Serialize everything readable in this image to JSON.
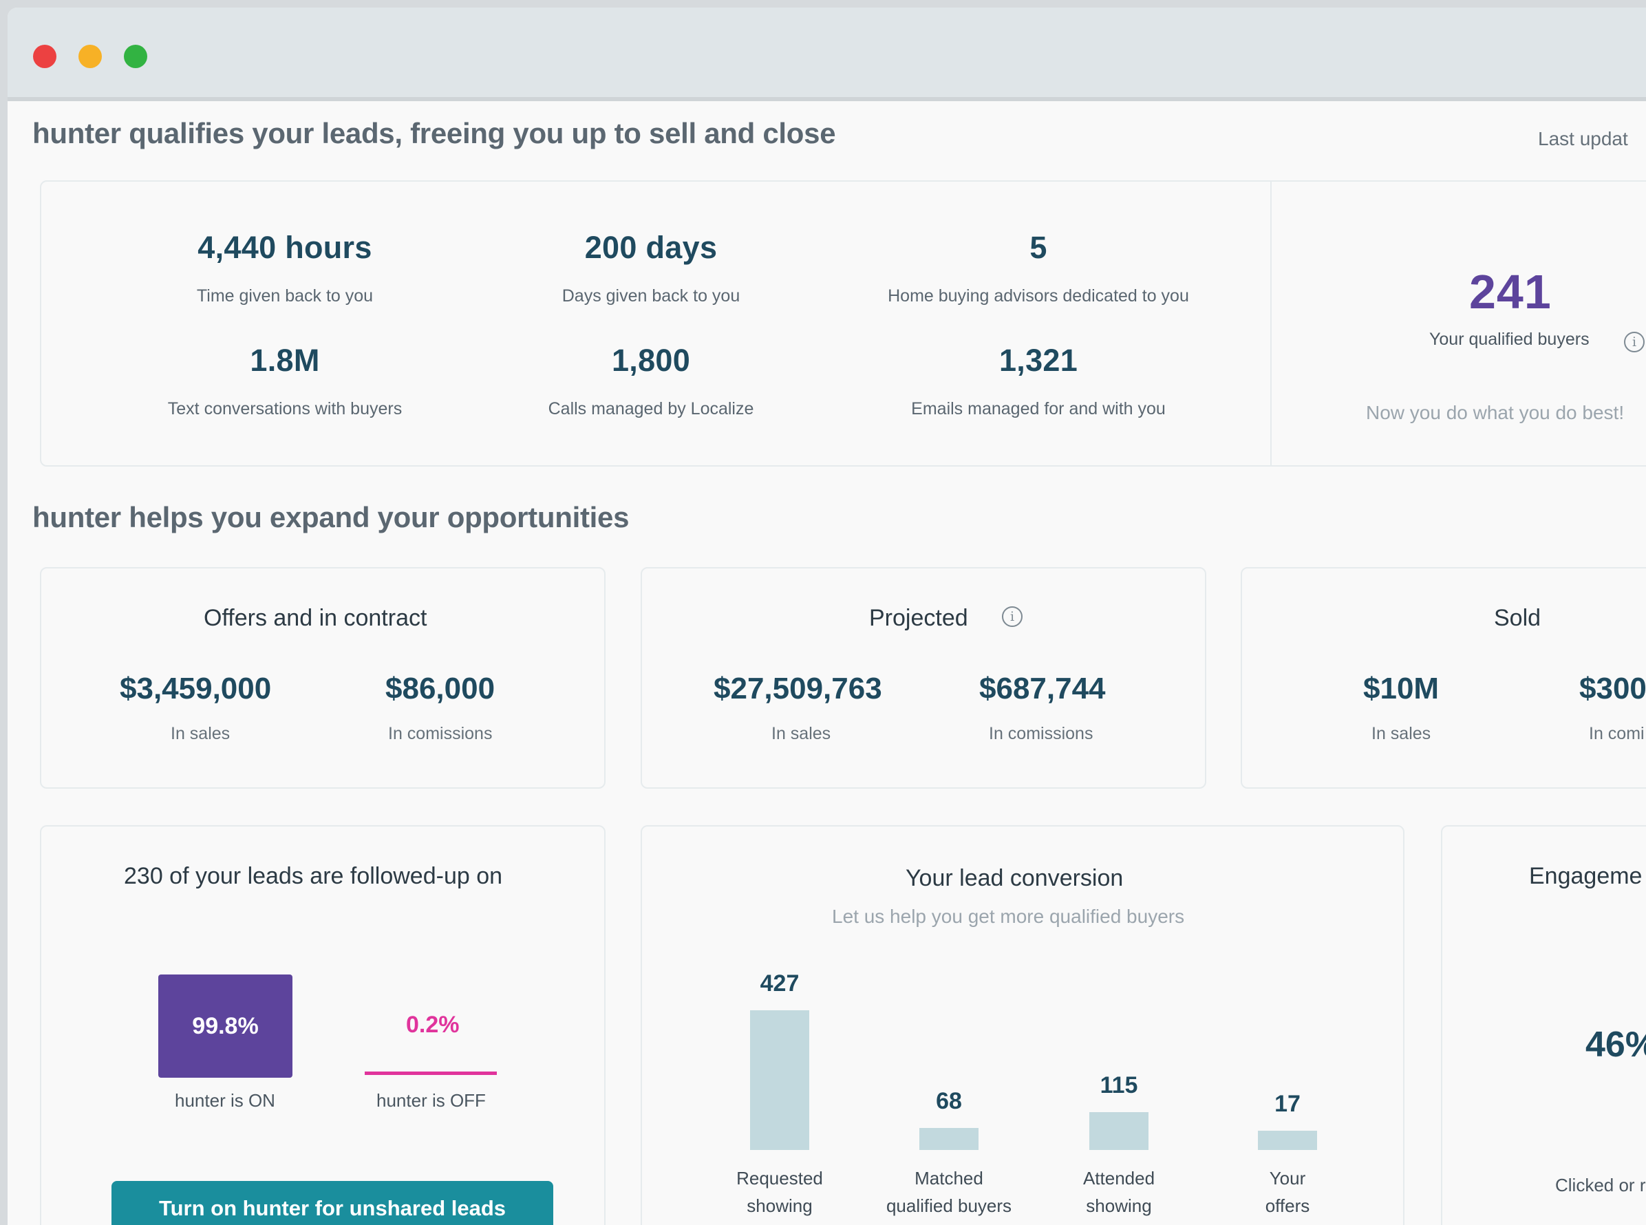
{
  "window": {
    "controls": [
      "close",
      "minimize",
      "maximize"
    ]
  },
  "header": {
    "title": "hunter qualifies your leads, freeing you up to sell and close",
    "last_update": "Last updat"
  },
  "summary": {
    "stats": [
      {
        "value": "4,440 hours",
        "label": "Time given back to you"
      },
      {
        "value": "200 days",
        "label": "Days given back to you"
      },
      {
        "value": "5",
        "label": "Home buying advisors dedicated to you"
      },
      {
        "value": "1.8M",
        "label": "Text conversations with buyers"
      },
      {
        "value": "1,800",
        "label": "Calls managed by Localize"
      },
      {
        "value": "1,321",
        "label": "Emails managed for and with you"
      }
    ],
    "qualified": {
      "value": "241",
      "label": "Your qualified buyers",
      "tagline": "Now you do what you do best!"
    }
  },
  "opportunities": {
    "title": "hunter helps you expand your opportunities",
    "cards": [
      {
        "title": "Offers and in contract",
        "sales": "$3,459,000",
        "sales_label": "In sales",
        "commissions": "$86,000",
        "commissions_label": "In comissions"
      },
      {
        "title": "Projected",
        "sales": "$27,509,763",
        "sales_label": "In sales",
        "commissions": "$687,744",
        "commissions_label": "In comissions"
      },
      {
        "title": "Sold",
        "sales": "$10M",
        "sales_label": "In sales",
        "commissions": "$300",
        "commissions_label": "In comi"
      }
    ]
  },
  "followup": {
    "title": "230 of your leads are followed-up on",
    "on_value": "99.8%",
    "on_label": "hunter is ON",
    "off_value": "0.2%",
    "off_label": "hunter is OFF",
    "cta": "Turn on hunter for unshared leads"
  },
  "conversion": {
    "title": "Your lead conversion",
    "subtitle": "Let us help you get more qualified buyers"
  },
  "chart_data": {
    "type": "bar",
    "categories": [
      "Requested showing",
      "Matched qualified buyers",
      "Attended showing",
      "Your offers"
    ],
    "category_lines": [
      [
        "Requested",
        "showing"
      ],
      [
        "Matched",
        "qualified buyers"
      ],
      [
        "Attended",
        "showing"
      ],
      [
        "Your",
        "offers"
      ]
    ],
    "values": [
      427,
      68,
      115,
      17
    ],
    "value_labels": [
      "427",
      "68",
      "115",
      "17"
    ],
    "bar_color": "#c2d9de"
  },
  "engagement": {
    "title": "Engageme",
    "value": "46%",
    "label": "Clicked or r"
  },
  "colors": {
    "accent_purple": "#5d449c",
    "accent_pink": "#e0349c",
    "cta_teal": "#1a8e9d",
    "text_dark": "#1f4a5f"
  },
  "icons": {
    "info": "info-icon"
  }
}
